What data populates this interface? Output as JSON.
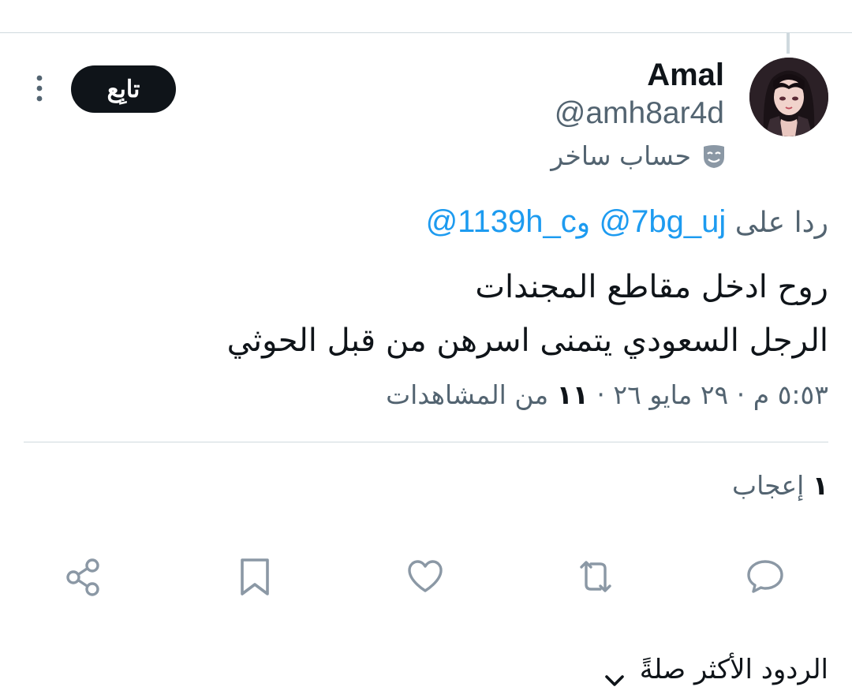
{
  "tweet": {
    "author": {
      "display_name": "Amal",
      "handle": "@amh8ar4d",
      "label": "حساب ساخر",
      "label_icon": "theater-mask-icon"
    },
    "follow_label": "تابِع",
    "reply_prefix": "ردا على",
    "reply_mentions": [
      "@7bg_uj",
      "@1139h_c"
    ],
    "reply_joiner": "و",
    "text_lines": [
      "روح ادخل مقاطع المجندات",
      "الرجل السعودي يتمنى اسرهن من قبل الحوثي"
    ],
    "meta": {
      "time": "٥:٥٣ م",
      "separator": "·",
      "date": "٢٩ مايو ٢٦",
      "views_count": "١١",
      "views_label": "من المشاهدات"
    },
    "likes": {
      "count": "١",
      "label": "إعجاب"
    },
    "actions": [
      "reply-icon",
      "retweet-icon",
      "like-icon",
      "bookmark-icon",
      "share-icon"
    ]
  },
  "replies_sort": {
    "label": "الردود الأكثر صلةً"
  },
  "colors": {
    "accent": "#1d9bf0",
    "text_primary": "#0f1419",
    "text_secondary": "#536471",
    "divider": "#cfd9de",
    "icon_gray": "#8b98a5"
  }
}
